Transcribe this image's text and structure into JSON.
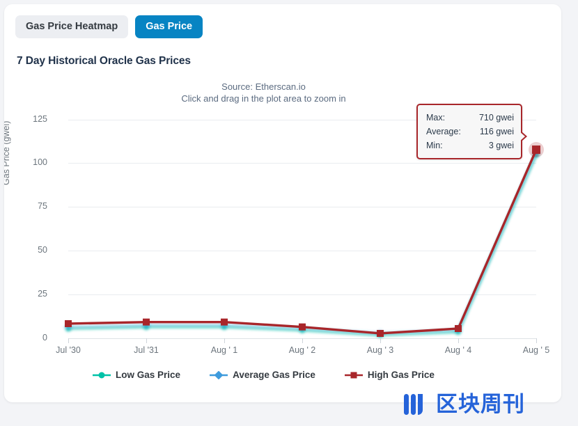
{
  "tabs": [
    {
      "label": "Gas Price Heatmap",
      "active": false
    },
    {
      "label": "Gas Price",
      "active": true
    }
  ],
  "card": {
    "title": "7 Day Historical Oracle Gas Prices"
  },
  "tooltip": {
    "rows": [
      {
        "key": "Max:",
        "value": "710 gwei"
      },
      {
        "key": "Average:",
        "value": "116 gwei"
      },
      {
        "key": "Min:",
        "value": "3 gwei"
      }
    ]
  },
  "watermark": {
    "text": "区块周刊"
  },
  "colors": {
    "tab_active_bg": "#0784c3",
    "tab_inactive_bg": "#eceef2",
    "low": "#00c2a8",
    "average": "#3e9bdd",
    "high": "#a8262a",
    "grid": "#e9ecef",
    "title": "#20324a"
  },
  "chart_data": {
    "type": "line",
    "title": "7 Day Historical Oracle Gas Prices",
    "subtitle_lines": [
      "Source: Etherscan.io",
      "Click and drag in the plot area to zoom in"
    ],
    "xlabel": "",
    "ylabel": "Gas Price (gwei)",
    "categories": [
      "Jul '30",
      "Jul '31",
      "Aug ' 1",
      "Aug ' 2",
      "Aug ' 3",
      "Aug ' 4",
      "Aug ' 5"
    ],
    "yticks": [
      0,
      25,
      50,
      75,
      100,
      125
    ],
    "ylim": [
      0,
      137
    ],
    "grid": true,
    "legend_position": "bottom",
    "series": [
      {
        "name": "Low Gas Price",
        "color": "#00c2a8",
        "marker": "circle",
        "values": [
          6,
          7,
          7,
          5,
          2,
          4,
          113
        ]
      },
      {
        "name": "Average Gas Price",
        "color": "#3e9bdd",
        "marker": "diamond",
        "values": [
          7,
          8,
          8,
          6,
          3,
          5,
          114
        ]
      },
      {
        "name": "High Gas Price",
        "color": "#a8262a",
        "marker": "square",
        "values": [
          9,
          10,
          10,
          7,
          3,
          6,
          116
        ]
      }
    ],
    "highlighted_point": {
      "series": "High Gas Price",
      "category": "Aug ' 5",
      "value": 116
    }
  }
}
